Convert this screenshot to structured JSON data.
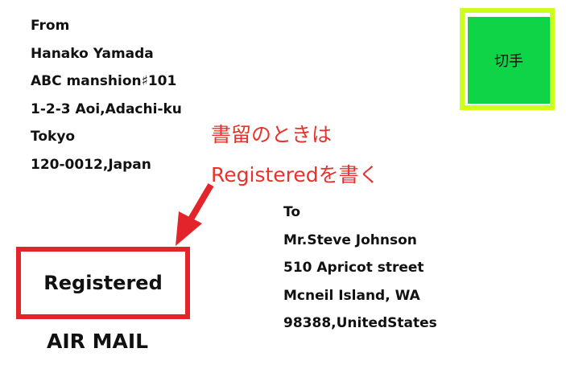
{
  "sender": {
    "lines": [
      "From",
      "Hanako Yamada",
      "ABC manshion♯101",
      "1-2-3 Aoi,Adachi-ku",
      "Tokyo",
      "120-0012,Japan"
    ]
  },
  "stamp": {
    "label": "切手",
    "border_color": "#ccff1a",
    "fill_color": "#10d447"
  },
  "note": {
    "line1": "書留のときは",
    "line2": "Registeredを書く",
    "color": "#e8322b"
  },
  "registered_box": {
    "label": "Registered",
    "border_color": "#e3242b"
  },
  "airmail": {
    "label": "AIR MAIL"
  },
  "recipient": {
    "lines": [
      "To",
      "Mr.Steve Johnson",
      "510 Apricot street",
      "Mcneil Island, WA",
      "98388,UnitedStates"
    ]
  }
}
